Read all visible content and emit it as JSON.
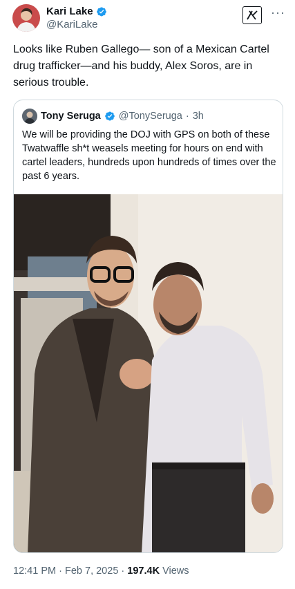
{
  "tweet": {
    "author": {
      "display_name": "Kari Lake",
      "handle": "@KariLake",
      "verified_color": "#1d9bf0"
    },
    "text": "Looks like Ruben Gallego— son of a Mexican Cartel drug trafficker—and his buddy, Alex Soros, are in serious trouble.",
    "actions": {
      "grok_icon": "grok-icon",
      "more_icon": "more-icon",
      "more_label": "···"
    },
    "quoted": {
      "display_name": "Tony Seruga",
      "handle": "@TonySeruga",
      "separator": "·",
      "time": "3h",
      "text": "We will be providing the DOJ with GPS on both of these Twatwaffle sh*t weasels meeting for hours on end with cartel leaders, hundreds upon hundreds of times over the past 6 years."
    },
    "meta": {
      "time": "12:41 PM",
      "sep1": "·",
      "date": "Feb 7, 2025",
      "sep2": "·",
      "views_count": "197.4K",
      "views_label": "Views"
    }
  }
}
